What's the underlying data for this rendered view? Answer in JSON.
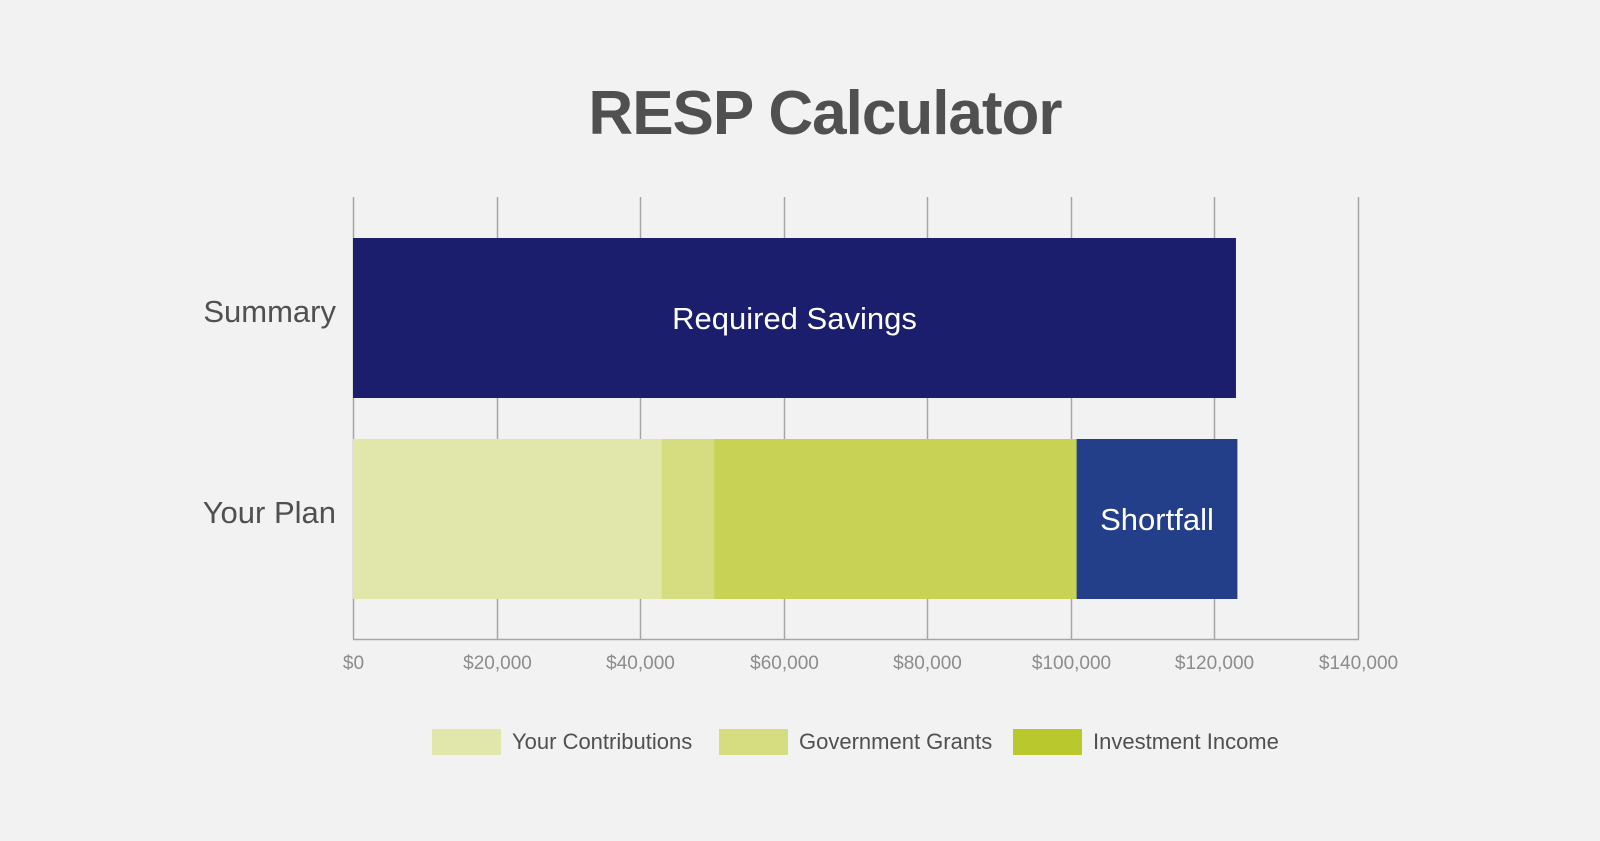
{
  "chart_data": {
    "type": "bar",
    "orientation": "horizontal",
    "stacked": true,
    "title": "RESP Calculator",
    "xlabel": "",
    "ylabel": "",
    "xlim": [
      0,
      140000
    ],
    "x_ticks": [
      0,
      20000,
      40000,
      60000,
      80000,
      100000,
      120000,
      140000
    ],
    "x_tick_labels": [
      "$0",
      "$20,000",
      "$40,000",
      "$60,000",
      "$80,000",
      "$100,000",
      "$120,000",
      "$140,000"
    ],
    "grid": true,
    "categories": [
      "Summary",
      "Your Plan"
    ],
    "bars": [
      {
        "category": "Summary",
        "segments": [
          {
            "name": "Required Savings",
            "value": 123000,
            "color": "#1b1d6d",
            "label": "Required Savings"
          }
        ]
      },
      {
        "category": "Your Plan",
        "segments": [
          {
            "name": "Your Contributions",
            "value": 43000,
            "color": "#e1e7ab",
            "label": ""
          },
          {
            "name": "Government Grants",
            "value": 7300,
            "color": "#d6dc80",
            "label": ""
          },
          {
            "name": "Investment Income",
            "value": 50500,
            "color": "#c8d356",
            "label": ""
          },
          {
            "name": "Shortfall",
            "value": 22400,
            "color": "#233f8a",
            "label": "Shortfall"
          }
        ]
      }
    ],
    "legend": {
      "position": "bottom",
      "items": [
        {
          "label": "Your Contributions",
          "color": "#e1e7ab"
        },
        {
          "label": "Government Grants",
          "color": "#d6dc80"
        },
        {
          "label": "Investment Income",
          "color": "#b9c82c"
        }
      ]
    }
  },
  "colors": {
    "background": "#f2f2f2",
    "grid": "#a6a6a6",
    "text": "#505050",
    "tick_text": "#8c8c8c"
  }
}
